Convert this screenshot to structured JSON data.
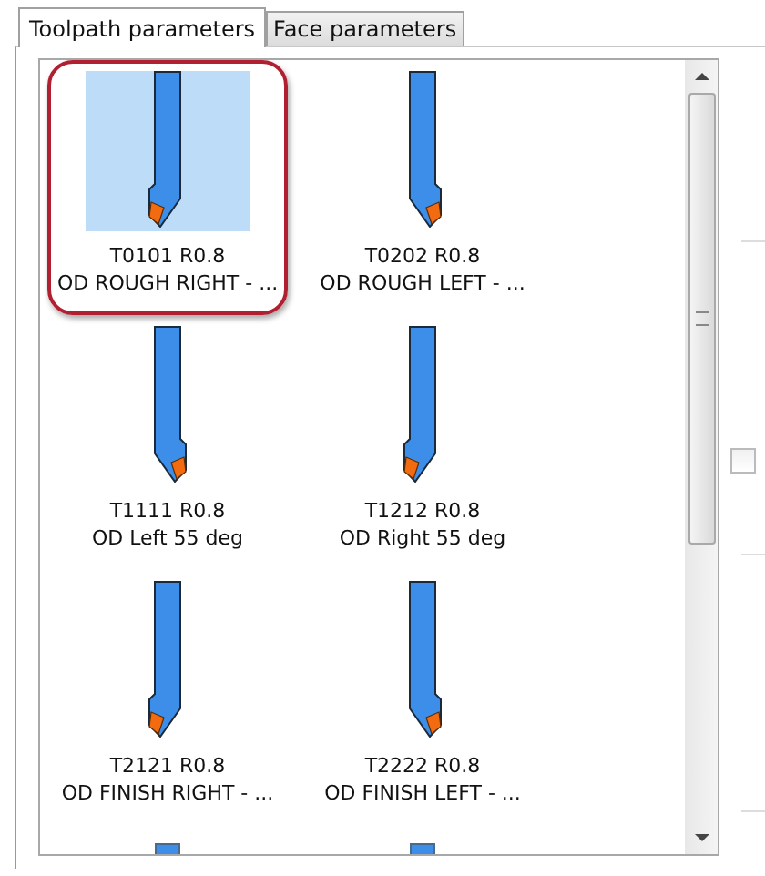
{
  "tabs": [
    {
      "label": "Toolpath parameters",
      "selected": true
    },
    {
      "label": "Face parameters",
      "selected": false
    }
  ],
  "tools": [
    {
      "kind": "tip-left",
      "code": "T0101 R0.8",
      "name": "OD ROUGH RIGHT - ...",
      "selected": true
    },
    {
      "kind": "tip-right",
      "code": "T0202 R0.8",
      "name": "OD ROUGH LEFT - ...",
      "selected": false
    },
    {
      "kind": "tip-right",
      "code": "T1111 R0.8",
      "name": "OD Left 55 deg",
      "selected": false
    },
    {
      "kind": "tip-left",
      "code": "T1212 R0.8",
      "name": "OD Right 55 deg",
      "selected": false
    },
    {
      "kind": "tip-left",
      "code": "T2121 R0.8",
      "name": "OD FINISH RIGHT - ...",
      "selected": false
    },
    {
      "kind": "tip-right",
      "code": "T2222 R0.8",
      "name": "OD FINISH LEFT - ...",
      "selected": false
    },
    {
      "kind": "partial"
    },
    {
      "kind": "partial"
    }
  ],
  "checkbox": {
    "checked": false
  }
}
